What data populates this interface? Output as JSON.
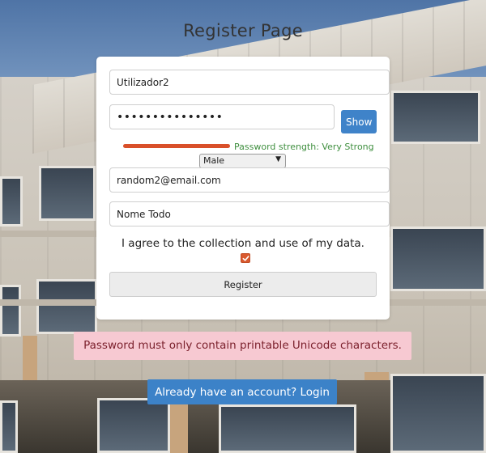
{
  "page": {
    "title": "Register Page"
  },
  "form": {
    "username_value": "Utilizador2",
    "password_value": "•••••••••••••••",
    "show_button_label": "Show",
    "password_strength": {
      "label": "Password strength: Very Strong",
      "color": "#d9502a"
    },
    "gender": {
      "selected": "Male"
    },
    "email_value": "random2@email.com",
    "name_value": "Nome Todo",
    "consent_label": "I agree to the collection and use of my data.",
    "consent_checked": true,
    "register_button_label": "Register"
  },
  "error": {
    "message": "Password must only contain printable Unicode characters."
  },
  "login_link": {
    "label": "Already have an account? Login"
  },
  "colors": {
    "primary_button": "#3c82c8",
    "error_background": "#f7c9d2",
    "strength_text": "#3f8f3f"
  }
}
